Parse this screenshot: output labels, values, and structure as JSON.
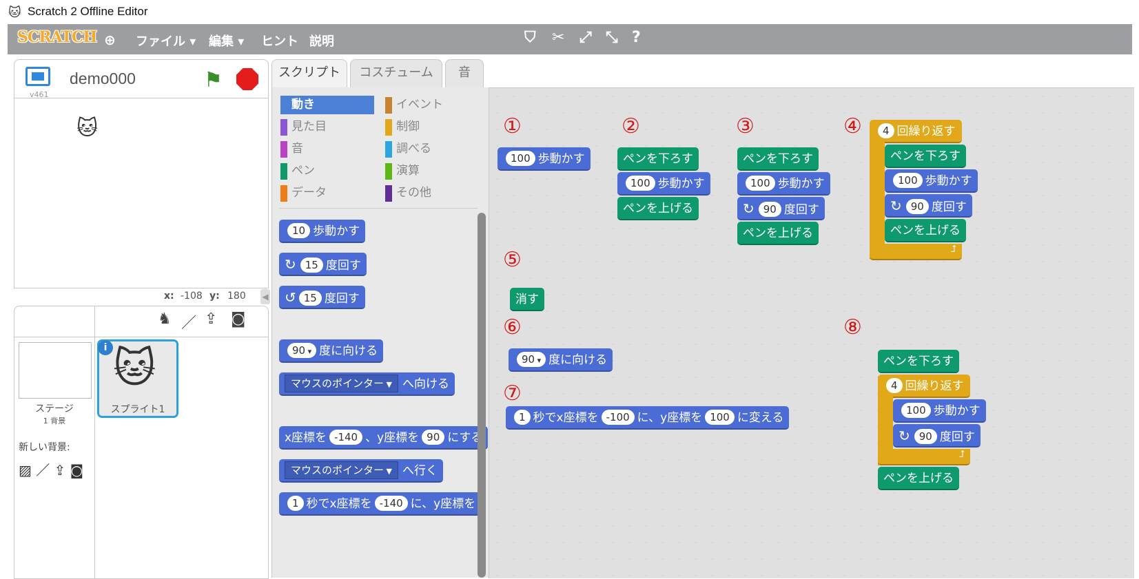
{
  "window": {
    "title": "Scratch 2 Offline Editor"
  },
  "menubar": {
    "logo": "SCRATCH",
    "file": "ファイル ▾",
    "edit": "編集 ▾",
    "hint": "ヒント",
    "about": "説明",
    "tools": [
      "duplicate-icon",
      "cut-icon",
      "grow-icon",
      "shrink-icon",
      "help-icon"
    ]
  },
  "stage": {
    "version": "v461",
    "project_title": "demo000",
    "x_label": "x:",
    "x_value": "-108",
    "y_label": "y:",
    "y_value": "180"
  },
  "sprites": {
    "stage_label": "ステージ",
    "stage_bg_count": "1 背景",
    "new_bg_label": "新しい背景:",
    "sprite_name": "スプライト1"
  },
  "tabs": [
    "スクリプト",
    "コスチューム",
    "音"
  ],
  "categories": [
    {
      "label": "動き",
      "color": "#4c7fd6"
    },
    {
      "label": "イベント",
      "color": "#c88330"
    },
    {
      "label": "見た目",
      "color": "#8a55d7"
    },
    {
      "label": "制御",
      "color": "#e1a91a"
    },
    {
      "label": "音",
      "color": "#bb42c3"
    },
    {
      "label": "調べる",
      "color": "#2ca5e2"
    },
    {
      "label": "ペン",
      "color": "#0e9a6c"
    },
    {
      "label": "演算",
      "color": "#5cb712"
    },
    {
      "label": "データ",
      "color": "#ee7d16"
    },
    {
      "label": "その他",
      "color": "#632d99"
    }
  ],
  "palette": {
    "move_steps": "10",
    "move_label": "歩動かす",
    "turn_cw": "15",
    "turn_ccw": "15",
    "turn_label": "度回す",
    "point_dir": "90",
    "point_label": "度に向ける",
    "point_towards": "マウスのポインター",
    "towards_label": "へ向ける",
    "goto_x_label": "x座標を",
    "goto_x": "-140",
    "goto_y_label": "、y座標を",
    "goto_y": "90",
    "goto_end": "にする",
    "goto_target": "マウスのポインター",
    "goto_label": "へ行く",
    "glide_secs": "1",
    "glide_label": "秒でx座標を",
    "glide_x": "-140",
    "glide_y_label": "に、y座標を"
  },
  "script": {
    "numbers": [
      "①",
      "②",
      "③",
      "④",
      "⑤",
      "⑥",
      "⑦",
      "⑧"
    ],
    "steps_100": "100",
    "steps_label": "歩動かす",
    "pen_down": "ペンを下ろす",
    "pen_up": "ペンを上げる",
    "turn_90": "90",
    "turn_label": "度回す",
    "repeat_count": "4",
    "repeat_label": "回繰り返す",
    "clear": "消す",
    "dir_90": "90",
    "dir_label": "度に向ける",
    "glide_secs": "1",
    "glide_label": "秒でx座標を",
    "glide_x": "-100",
    "glide_mid": "に、y座標を",
    "glide_y": "100",
    "glide_end": "に変える"
  }
}
